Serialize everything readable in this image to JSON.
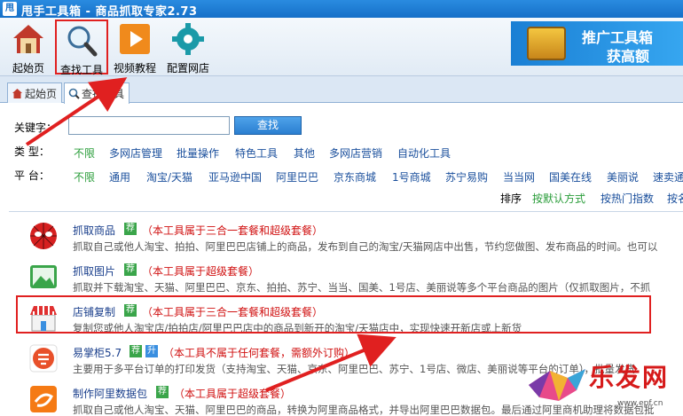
{
  "window": {
    "app_icon": "甩",
    "title": "甩手工具箱 - 商品抓取专家2.73"
  },
  "toolbar": {
    "buttons": [
      {
        "label": "起始页",
        "icon": "home-icon"
      },
      {
        "label": "查找工具",
        "icon": "magnifier-icon"
      },
      {
        "label": "视频教程",
        "icon": "play-icon"
      },
      {
        "label": "配置网店",
        "icon": "gear-icon"
      }
    ],
    "ad": {
      "line1": "推广工具箱",
      "line2": "获高额"
    }
  },
  "tabs": [
    {
      "label": "起始页"
    },
    {
      "label": "查找工具"
    }
  ],
  "filter": {
    "keyword_label": "关键字：",
    "keyword_value": "",
    "search_button": "查找",
    "type_label": "类  型：",
    "types": [
      "不限",
      "多网店管理",
      "批量操作",
      "特色工具",
      "其他",
      "多网店营销",
      "自动化工具"
    ],
    "platform_label": "平  台：",
    "platforms": [
      "不限",
      "通用",
      "淘宝/天猫",
      "亚马逊中国",
      "阿里巴巴",
      "京东商城",
      "1号商城",
      "苏宁易购",
      "当当网",
      "国美在线",
      "美丽说",
      "速卖通"
    ],
    "sort_label": "排序",
    "sorts": [
      "按默认方式",
      "按热门指数",
      "按名"
    ]
  },
  "items": [
    {
      "name": "抓取商品",
      "badges": [
        "荐"
      ],
      "note": "（本工具属于三合一套餐和超级套餐）",
      "desc": "抓取自己或他人淘宝、拍拍、阿里巴巴店铺上的商品，发布到自己的淘宝/天猫网店中出售，节约您做图、发布商品的时间。也可以"
    },
    {
      "name": "抓取图片",
      "badges": [
        "荐"
      ],
      "note": "（本工具属于超级套餐）",
      "desc": "抓取并下载淘宝、天猫、阿里巴巴、京东、拍拍、苏宁、当当、国美、1号店、美丽说等多个平台商品的图片（仅抓取图片，不抓"
    },
    {
      "name": "店铺复制",
      "badges": [
        "荐"
      ],
      "note": "（本工具属于三合一套餐和超级套餐）",
      "desc": "复制您或他人淘宝店/拍拍店/阿里巴巴店中的商品到新开的淘宝/天猫店中，实现快速开新店或上新货"
    },
    {
      "name": "易掌柜5.7",
      "badges": [
        "荐",
        "升"
      ],
      "note": "（本工具不属于任何套餐，需额外订购）",
      "desc": "主要用于多平台订单的打印发货（支持淘宝、天猫、京东、阿里巴巴、苏宁、1号店、微店、美丽说等平台的订单），批量发货"
    },
    {
      "name": "制作阿里数据包",
      "badges": [
        "荐"
      ],
      "note": "（本工具属于超级套餐）",
      "desc": "抓取自己或他人淘宝、天猫、阿里巴巴的商品，转换为阿里商品格式，并导出阿里巴巴数据包。最后通过阿里商机助理将数据包批"
    }
  ],
  "watermark": {
    "text": "乐发网",
    "url": "www.epf.cn"
  }
}
